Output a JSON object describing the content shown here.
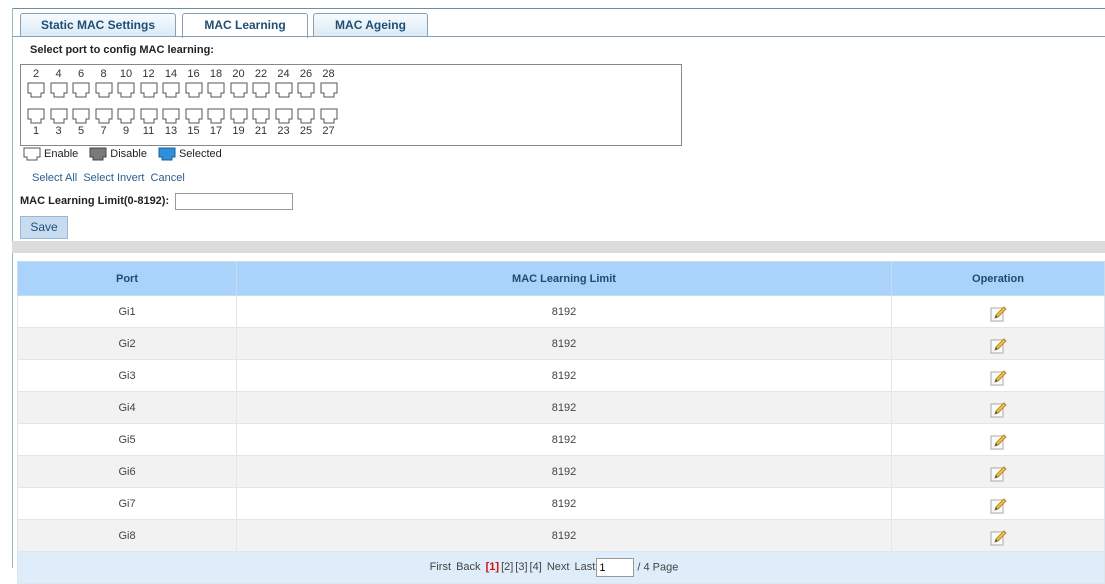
{
  "tabs": [
    {
      "label": "Static MAC Settings"
    },
    {
      "label": "MAC Learning"
    },
    {
      "label": "MAC Ageing"
    }
  ],
  "port_select": {
    "title": "Select port to config MAC learning:",
    "top_numbers": [
      "2",
      "4",
      "6",
      "8",
      "10",
      "12",
      "14",
      "16",
      "18",
      "20",
      "22",
      "24",
      "26",
      "28"
    ],
    "bottom_numbers": [
      "1",
      "3",
      "5",
      "7",
      "9",
      "11",
      "13",
      "15",
      "17",
      "19",
      "21",
      "23",
      "25",
      "27"
    ]
  },
  "legend": {
    "enable": "Enable",
    "disable": "Disable",
    "selected": "Selected"
  },
  "links": {
    "select_all": "Select All",
    "select_invert": "Select Invert",
    "cancel": "Cancel"
  },
  "limit": {
    "label": "MAC Learning Limit(0-8192):",
    "value": ""
  },
  "save_label": "Save",
  "table": {
    "headers": [
      "Port",
      "MAC Learning Limit",
      "Operation"
    ],
    "rows": [
      {
        "port": "Gi1",
        "limit": "8192"
      },
      {
        "port": "Gi2",
        "limit": "8192"
      },
      {
        "port": "Gi3",
        "limit": "8192"
      },
      {
        "port": "Gi4",
        "limit": "8192"
      },
      {
        "port": "Gi5",
        "limit": "8192"
      },
      {
        "port": "Gi6",
        "limit": "8192"
      },
      {
        "port": "Gi7",
        "limit": "8192"
      },
      {
        "port": "Gi8",
        "limit": "8192"
      }
    ],
    "operation_icon": "edit-icon"
  },
  "pager": {
    "first": "First",
    "back": "Back",
    "pages": [
      "[1]",
      "[2]",
      "[3]",
      "[4]"
    ],
    "current_index": 0,
    "next": "Next",
    "last": "Last",
    "page_input": "1",
    "total": "/ 4 Page"
  },
  "colors": {
    "accent": "#a9d3fb",
    "pager_bg": "#deedf9",
    "current_page": "#d01010",
    "link": "#2a5e8c"
  }
}
